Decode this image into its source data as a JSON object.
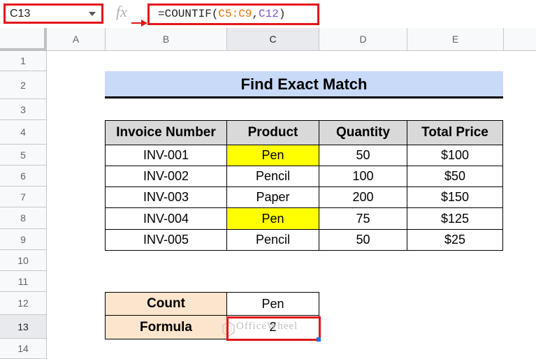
{
  "formula_bar": {
    "name_box": "C13",
    "fx_symbol": "fx",
    "formula_prefix": "=COUNTIF(",
    "formula_ref1": "C5:C9",
    "formula_sep": ",",
    "formula_ref2": "C12",
    "formula_suffix": ")"
  },
  "columns": [
    "A",
    "B",
    "C",
    "D",
    "E"
  ],
  "rows": [
    "1",
    "2",
    "3",
    "4",
    "5",
    "6",
    "7",
    "8",
    "9",
    "10",
    "11",
    "12",
    "13",
    "14"
  ],
  "title": "Find Exact Match",
  "table": {
    "headers": [
      "Invoice Number",
      "Product",
      "Quantity",
      "Total Price"
    ],
    "rows": [
      [
        "INV-001",
        "Pen",
        "50",
        "$100"
      ],
      [
        "INV-002",
        "Pencil",
        "100",
        "$50"
      ],
      [
        "INV-003",
        "Paper",
        "200",
        "$150"
      ],
      [
        "INV-004",
        "Pen",
        "75",
        "$125"
      ],
      [
        "INV-005",
        "Pencil",
        "50",
        "$25"
      ]
    ]
  },
  "summary": {
    "count_label": "Count",
    "count_value": "Pen",
    "formula_label": "Formula",
    "formula_value": "2"
  },
  "watermark": "OfficeWheel",
  "colors": {
    "highlight_red": "#e3151a",
    "title_fill": "#c9daf8",
    "header_fill": "#d9d9d9",
    "match_fill": "#ffff00",
    "summary_fill": "#fce5cd"
  }
}
